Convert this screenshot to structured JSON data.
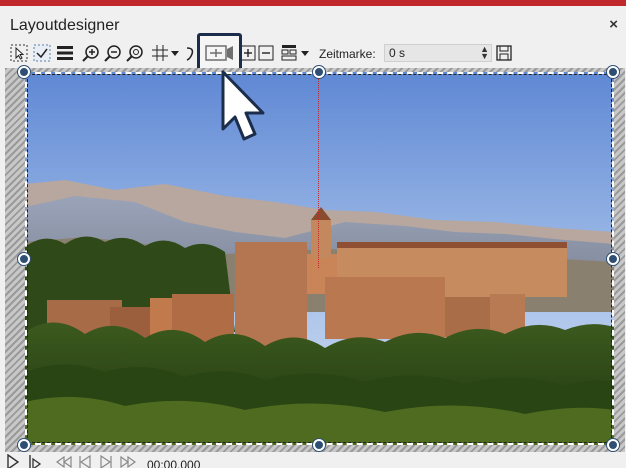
{
  "window": {
    "title": "Layoutdesigner",
    "close_glyph": "×",
    "accent_color": "#c0282c"
  },
  "toolbar": {
    "items": [
      {
        "name": "select-tool-icon"
      },
      {
        "name": "checkbox-tool-icon"
      },
      {
        "name": "list-icon"
      },
      {
        "name": "zoom-in-icon"
      },
      {
        "name": "zoom-out-icon"
      },
      {
        "name": "zoom-fit-icon"
      },
      {
        "name": "grid-icon"
      },
      {
        "name": "grid-dropdown-icon"
      },
      {
        "name": "curve-icon"
      },
      {
        "name": "fit-to-frame-icon"
      },
      {
        "name": "add-object-icon"
      },
      {
        "name": "remove-object-icon"
      },
      {
        "name": "align-icon"
      },
      {
        "name": "align-dropdown-icon"
      }
    ],
    "timestamp_label": "Zeitmarke:",
    "timestamp_value": "0 s",
    "save_icon": "save-icon"
  },
  "canvas": {
    "frame_color": "#2e4f73"
  },
  "transport": {
    "time": "00:00.000",
    "controls": [
      "play-icon",
      "play-from-start-icon",
      "rewind-icon",
      "previous-frame-icon",
      "next-frame-icon",
      "fast-forward-icon"
    ]
  }
}
